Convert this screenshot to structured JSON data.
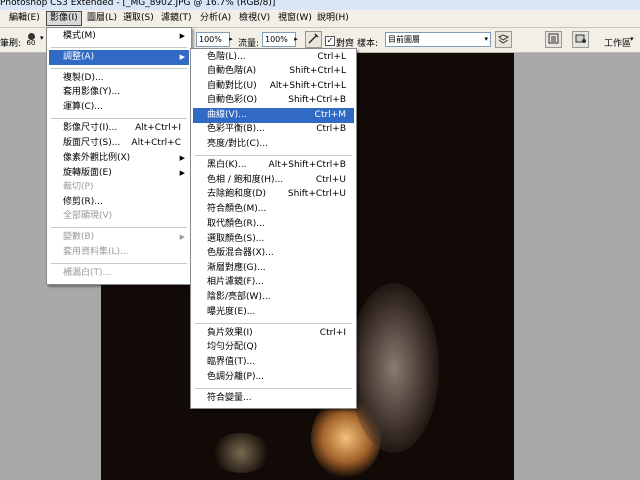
{
  "title": "Photoshop CS3 Extended - [_MG_8902.JPG @ 16.7% (RGB/8)]",
  "menubar": [
    "編輯(E)",
    "影像(I)",
    "圖層(L)",
    "選取(S)",
    "濾鏡(T)",
    "分析(A)",
    "檢視(V)",
    "視窗(W)",
    "說明(H)"
  ],
  "options": {
    "brush_label": "筆刷:",
    "brush_size": "60",
    "opacity_value": "100%",
    "flow_label": "流量:",
    "flow_value": "100%",
    "align_label": "對齊",
    "sample_label": "樣本:",
    "sample_value": "目前圖層",
    "workspace_label": "工作區"
  },
  "image_menu": [
    {
      "label": "模式(M)",
      "arrow": true
    },
    {
      "label": "調整(A)",
      "arrow": true,
      "highlight": true
    },
    {
      "label": "複製(D)..."
    },
    {
      "label": "套用影像(Y)..."
    },
    {
      "label": "運算(C)..."
    },
    {
      "label": "影像尺寸(I)...",
      "shortcut": "Alt+Ctrl+I"
    },
    {
      "label": "版面尺寸(S)...",
      "shortcut": "Alt+Ctrl+C"
    },
    {
      "label": "像素外觀比例(X)",
      "arrow": true
    },
    {
      "label": "旋轉版面(E)",
      "arrow": true
    },
    {
      "label": "裁切(P)",
      "disabled": true
    },
    {
      "label": "修剪(R)..."
    },
    {
      "label": "全部顯現(V)",
      "disabled": true
    },
    {
      "label": "變數(B)",
      "arrow": true,
      "disabled": true
    },
    {
      "label": "套用資料集(L)...",
      "disabled": true
    },
    {
      "label": "補漏白(T)...",
      "disabled": true
    }
  ],
  "adjust_menu": [
    {
      "label": "色階(L)...",
      "shortcut": "Ctrl+L"
    },
    {
      "label": "自動色階(A)",
      "shortcut": "Shift+Ctrl+L"
    },
    {
      "label": "自動對比(U)",
      "shortcut": "Alt+Shift+Ctrl+L"
    },
    {
      "label": "自動色彩(O)",
      "shortcut": "Shift+Ctrl+B"
    },
    {
      "label": "曲線(V)...",
      "shortcut": "Ctrl+M",
      "highlight": true
    },
    {
      "label": "色彩平衡(B)...",
      "shortcut": "Ctrl+B"
    },
    {
      "label": "亮度/對比(C)..."
    },
    {
      "label": "黑白(K)...",
      "shortcut": "Alt+Shift+Ctrl+B"
    },
    {
      "label": "色相 / 飽和度(H)...",
      "shortcut": "Ctrl+U"
    },
    {
      "label": "去除飽和度(D)",
      "shortcut": "Shift+Ctrl+U"
    },
    {
      "label": "符合顏色(M)..."
    },
    {
      "label": "取代顏色(R)..."
    },
    {
      "label": "選取顏色(S)..."
    },
    {
      "label": "色版混合器(X)..."
    },
    {
      "label": "漸層對應(G)..."
    },
    {
      "label": "相片濾鏡(F)..."
    },
    {
      "label": "陰影/亮部(W)..."
    },
    {
      "label": "曝光度(E)..."
    },
    {
      "label": "負片效果(I)",
      "shortcut": "Ctrl+I"
    },
    {
      "label": "均勻分配(Q)"
    },
    {
      "label": "臨界值(T)..."
    },
    {
      "label": "色調分離(P)..."
    },
    {
      "label": "符合變量..."
    }
  ]
}
